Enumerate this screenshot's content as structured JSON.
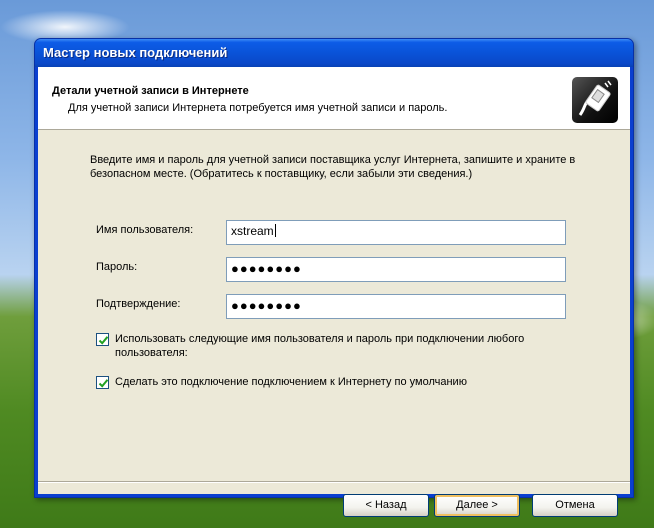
{
  "window": {
    "title": "Мастер новых подключений"
  },
  "header": {
    "title": "Детали учетной записи в Интернете",
    "subtitle": "Для учетной записи Интернета потребуется имя учетной записи и пароль.",
    "icon": "network-cable-icon"
  },
  "intro_text": "Введите имя и пароль для учетной записи поставщика услуг Интернета, запишите и храните в безопасном месте. (Обратитесь к поставщику, если забыли эти сведения.)",
  "fields": {
    "username": {
      "label": "Имя пользователя:",
      "value": "xstream"
    },
    "password": {
      "label": "Пароль:",
      "value": "●●●●●●●●"
    },
    "confirm": {
      "label": "Подтверждение:",
      "value": "●●●●●●●●"
    }
  },
  "checkboxes": {
    "use_for_all": {
      "label": "Использовать следующие имя пользователя и пароль при подключении любого пользователя:",
      "checked": true
    },
    "default_connection": {
      "label": "Сделать это подключение подключением к Интернету по умолчанию",
      "checked": true
    }
  },
  "buttons": {
    "back": "< Назад",
    "next": "Далее >",
    "cancel": "Отмена"
  },
  "colors": {
    "titlebar": "#0a53d8",
    "dialog_bg": "#ece9d8",
    "check": "#21a121"
  }
}
